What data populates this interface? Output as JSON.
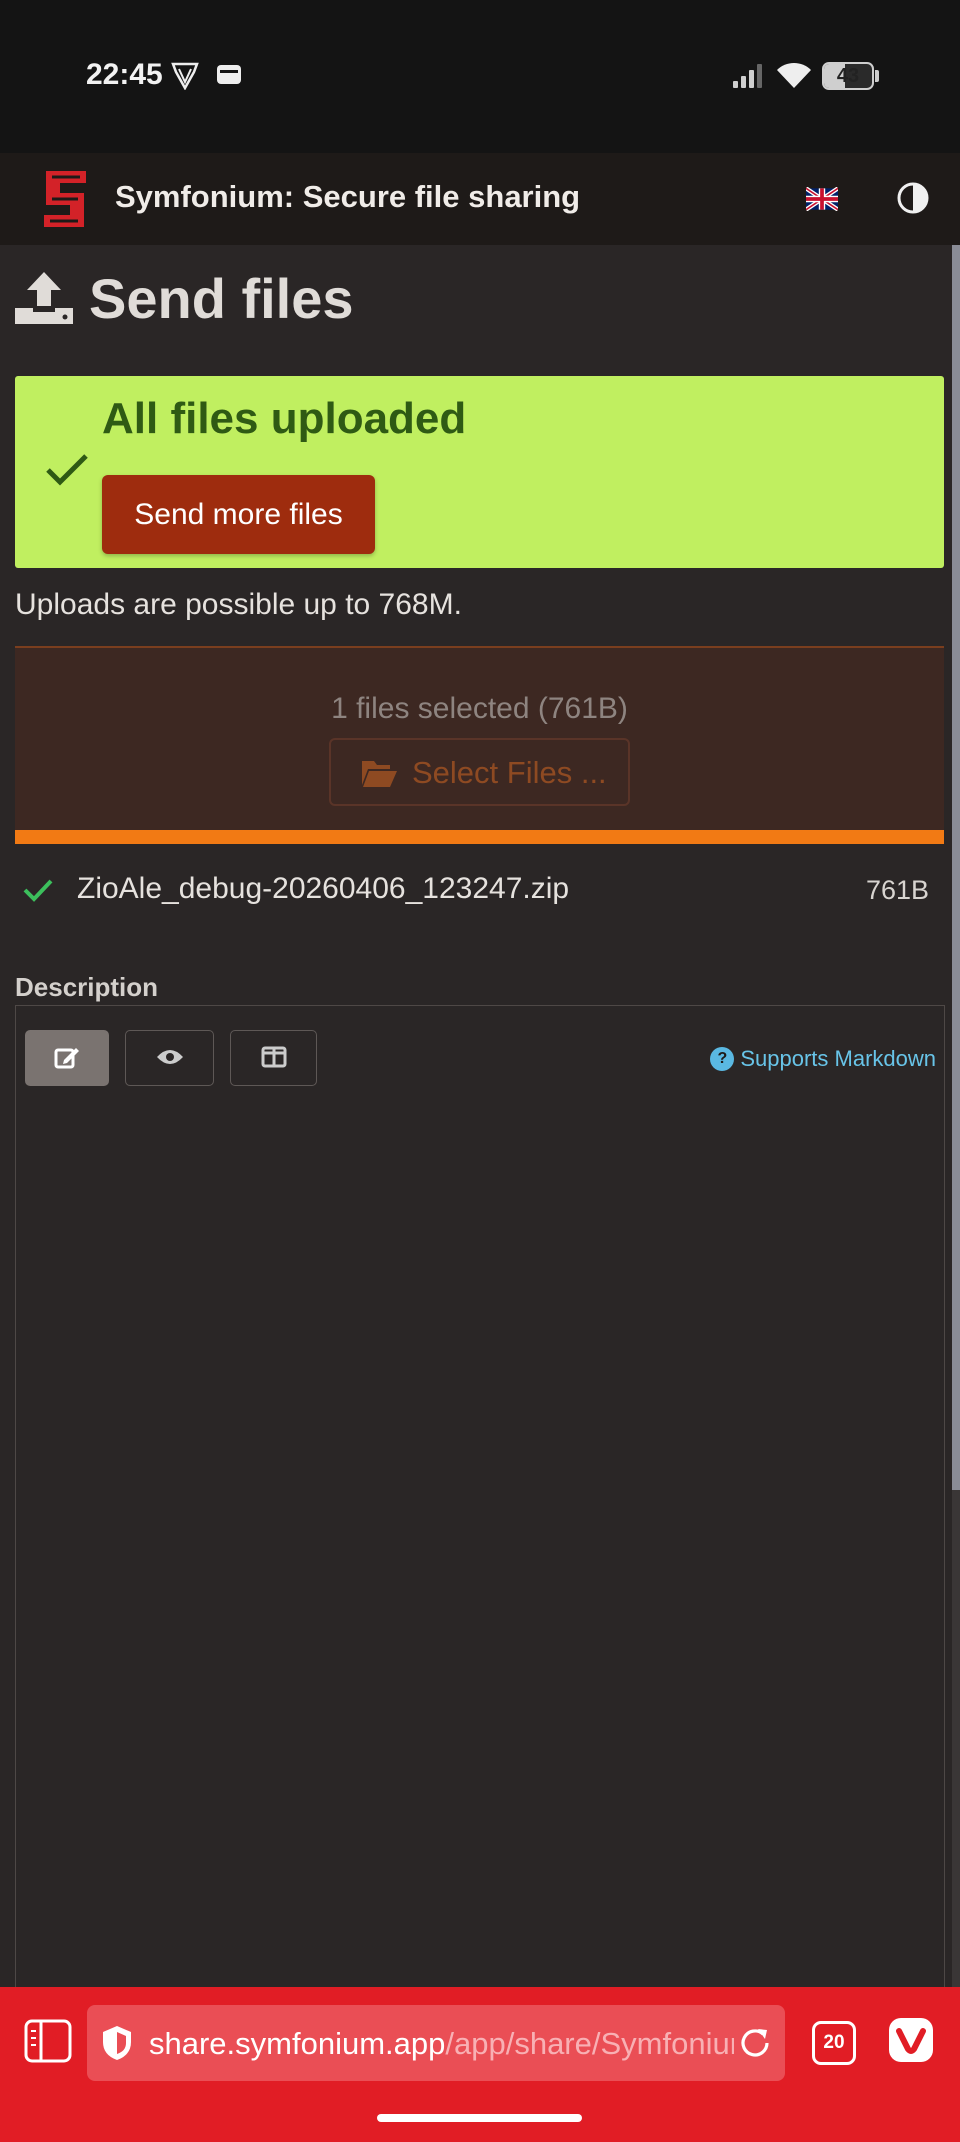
{
  "status_bar": {
    "time": "22:45",
    "battery": "43",
    "battery_level": 0.43,
    "icons": [
      "vpn-shield-icon",
      "wallet-icon",
      "signal-icon",
      "wifi-icon",
      "battery-icon"
    ]
  },
  "header": {
    "app_title": "Symfonium: Secure file sharing",
    "logo": "symfonium-logo",
    "language": "english-flag-icon",
    "theme_icon": "contrast-icon"
  },
  "page": {
    "title": "Send files",
    "icon": "upload-icon"
  },
  "success": {
    "title": "All files uploaded",
    "send_more_label": "Send more files"
  },
  "upload_limit_text": "Uploads are possible up to 768M.",
  "dropzone": {
    "selected_text": "1 files selected (761B)",
    "select_button_label": "Select Files ...",
    "progress": 1.0
  },
  "files": [
    {
      "name": "ZioAle_debug-20260406_123247.zip",
      "size": "761B",
      "status": "uploaded"
    }
  ],
  "description": {
    "label": "Description",
    "value": "",
    "toolbar": [
      "edit-icon",
      "preview-icon",
      "split-view-icon"
    ],
    "markdown_help": "Supports Markdown"
  },
  "browser": {
    "url_host": "share.symfonium.app",
    "url_path": "/app/share/Symfonium",
    "tab_count": "20"
  },
  "colors": {
    "brand_red": "#e11d25",
    "success_bg": "#c0ef60",
    "success_text": "#2f5a14",
    "primary_button": "#9e2c0e",
    "progress": "#f27a14",
    "page_bg": "#2a2626",
    "link": "#68c4e8"
  }
}
